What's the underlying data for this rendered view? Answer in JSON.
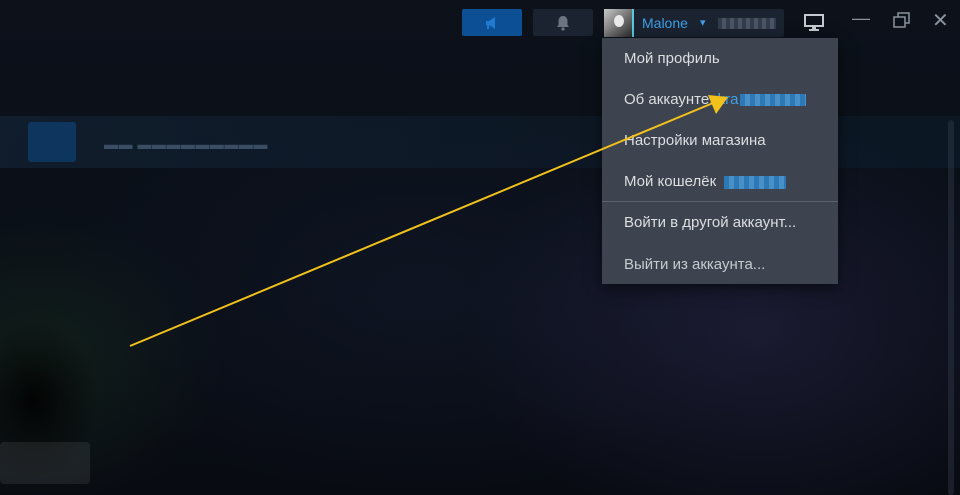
{
  "titlebar": {
    "announce_icon": "megaphone-icon",
    "notify_icon": "bell-icon",
    "account_name": "Malone",
    "view_icon": "monitor-icon",
    "minimize_glyph": "—",
    "close_glyph": "✕"
  },
  "account_menu": {
    "items": [
      {
        "label": "Мой профиль"
      },
      {
        "label": "Об аккаунте:",
        "link": "kra"
      },
      {
        "label": "Настройки магазина"
      },
      {
        "label": "Мой кошелёк"
      },
      {
        "label": "Войти в другой аккаунт..."
      },
      {
        "label": "Выйти из аккаунта..."
      }
    ]
  },
  "colors": {
    "accent": "#3f9fe6",
    "menu_bg": "#3d4450",
    "annotation_arrow": "#f2c21b"
  }
}
